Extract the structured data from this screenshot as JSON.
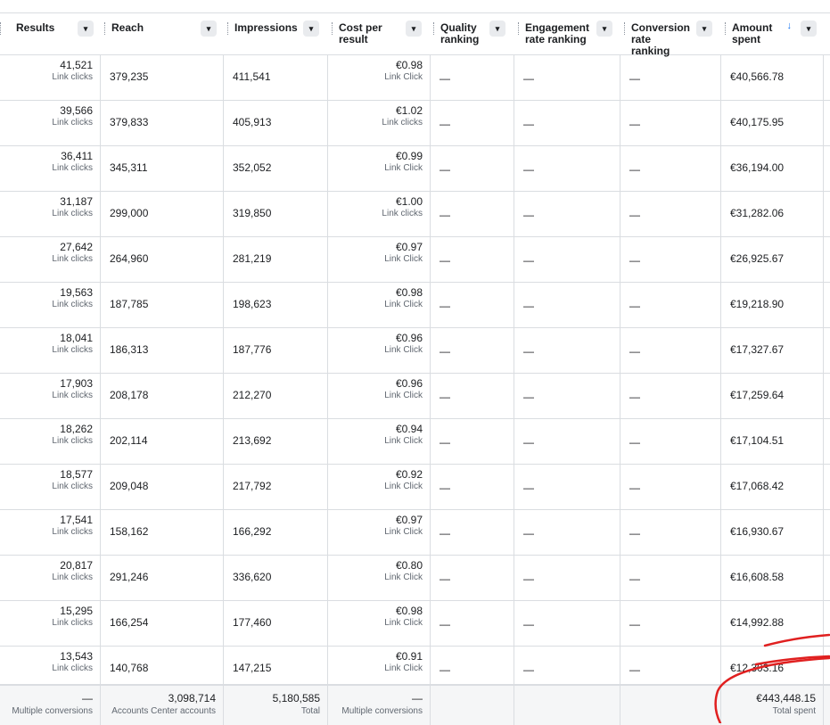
{
  "headers": {
    "results": "Results",
    "reach": "Reach",
    "impressions": "Impressions",
    "cost": "Cost per result",
    "quality": "Quality ranking",
    "engagement": "Engagement rate ranking",
    "conversion": "Conversion rate ranking",
    "amount": "Amount spent",
    "dropdown_icon": "▾",
    "sort_icon": "↓"
  },
  "rows": [
    {
      "results": "41,521",
      "results_sub": "Link clicks",
      "reach": "379,235",
      "impressions": "411,541",
      "cost": "€0.98",
      "cost_sub": "Link Click",
      "quality": "—",
      "engagement": "—",
      "conversion": "—",
      "amount": "€40,566.78"
    },
    {
      "results": "39,566",
      "results_sub": "Link clicks",
      "reach": "379,833",
      "impressions": "405,913",
      "cost": "€1.02",
      "cost_sub": "Link clicks",
      "quality": "—",
      "engagement": "—",
      "conversion": "—",
      "amount": "€40,175.95"
    },
    {
      "results": "36,411",
      "results_sub": "Link clicks",
      "reach": "345,311",
      "impressions": "352,052",
      "cost": "€0.99",
      "cost_sub": "Link Click",
      "quality": "—",
      "engagement": "—",
      "conversion": "—",
      "amount": "€36,194.00"
    },
    {
      "results": "31,187",
      "results_sub": "Link clicks",
      "reach": "299,000",
      "impressions": "319,850",
      "cost": "€1.00",
      "cost_sub": "Link clicks",
      "quality": "—",
      "engagement": "—",
      "conversion": "—",
      "amount": "€31,282.06"
    },
    {
      "results": "27,642",
      "results_sub": "Link clicks",
      "reach": "264,960",
      "impressions": "281,219",
      "cost": "€0.97",
      "cost_sub": "Link Click",
      "quality": "—",
      "engagement": "—",
      "conversion": "—",
      "amount": "€26,925.67"
    },
    {
      "results": "19,563",
      "results_sub": "Link clicks",
      "reach": "187,785",
      "impressions": "198,623",
      "cost": "€0.98",
      "cost_sub": "Link Click",
      "quality": "—",
      "engagement": "—",
      "conversion": "—",
      "amount": "€19,218.90"
    },
    {
      "results": "18,041",
      "results_sub": "Link clicks",
      "reach": "186,313",
      "impressions": "187,776",
      "cost": "€0.96",
      "cost_sub": "Link Click",
      "quality": "—",
      "engagement": "—",
      "conversion": "—",
      "amount": "€17,327.67"
    },
    {
      "results": "17,903",
      "results_sub": "Link clicks",
      "reach": "208,178",
      "impressions": "212,270",
      "cost": "€0.96",
      "cost_sub": "Link Click",
      "quality": "—",
      "engagement": "—",
      "conversion": "—",
      "amount": "€17,259.64"
    },
    {
      "results": "18,262",
      "results_sub": "Link clicks",
      "reach": "202,114",
      "impressions": "213,692",
      "cost": "€0.94",
      "cost_sub": "Link Click",
      "quality": "—",
      "engagement": "—",
      "conversion": "—",
      "amount": "€17,104.51"
    },
    {
      "results": "18,577",
      "results_sub": "Link clicks",
      "reach": "209,048",
      "impressions": "217,792",
      "cost": "€0.92",
      "cost_sub": "Link Click",
      "quality": "—",
      "engagement": "—",
      "conversion": "—",
      "amount": "€17,068.42"
    },
    {
      "results": "17,541",
      "results_sub": "Link clicks",
      "reach": "158,162",
      "impressions": "166,292",
      "cost": "€0.97",
      "cost_sub": "Link Click",
      "quality": "—",
      "engagement": "—",
      "conversion": "—",
      "amount": "€16,930.67"
    },
    {
      "results": "20,817",
      "results_sub": "Link clicks",
      "reach": "291,246",
      "impressions": "336,620",
      "cost": "€0.80",
      "cost_sub": "Link Click",
      "quality": "—",
      "engagement": "—",
      "conversion": "—",
      "amount": "€16,608.58"
    },
    {
      "results": "15,295",
      "results_sub": "Link clicks",
      "reach": "166,254",
      "impressions": "177,460",
      "cost": "€0.98",
      "cost_sub": "Link Click",
      "quality": "—",
      "engagement": "—",
      "conversion": "—",
      "amount": "€14,992.88"
    },
    {
      "results": "13,543",
      "results_sub": "Link clicks",
      "reach": "140,768",
      "impressions": "147,215",
      "cost": "€0.91",
      "cost_sub": "Link Click",
      "quality": "—",
      "engagement": "—",
      "conversion": "—",
      "amount": "€12,303.16"
    }
  ],
  "totals": {
    "results": "—",
    "results_sub": "Multiple conversions",
    "reach": "3,098,714",
    "reach_sub": "Accounts Center accounts",
    "impressions": "5,180,585",
    "impressions_sub": "Total",
    "cost": "—",
    "cost_sub": "Multiple conversions",
    "amount": "€443,448.15",
    "amount_sub": "Total spent"
  },
  "colors": {
    "annotation": "#e02020",
    "sort_accent": "#1877f2"
  }
}
